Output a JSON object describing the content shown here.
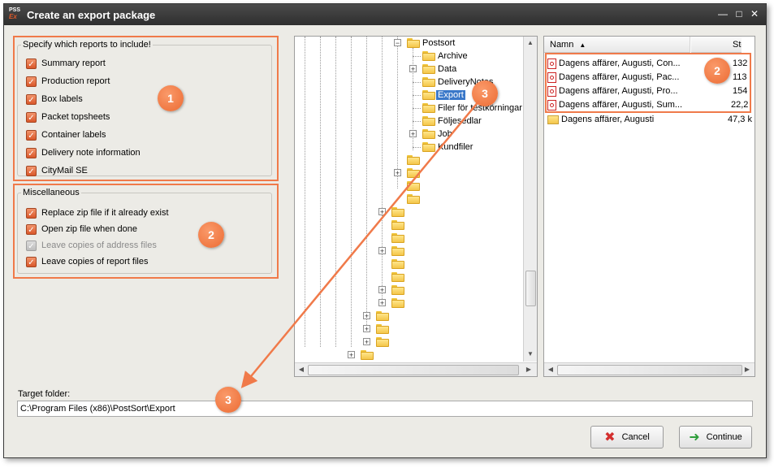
{
  "window": {
    "title": "Create an export package",
    "app_icon_text": "PSS",
    "app_icon_sub": "Ex"
  },
  "reports_group": {
    "legend": "Specify which reports to include!",
    "items": [
      {
        "label": "Summary report",
        "checked": true
      },
      {
        "label": "Production report",
        "checked": true
      },
      {
        "label": "Box labels",
        "checked": true
      },
      {
        "label": "Packet topsheets",
        "checked": true
      },
      {
        "label": "Container labels",
        "checked": true
      },
      {
        "label": "Delivery note information",
        "checked": true
      },
      {
        "label": "CityMail SE",
        "checked": true
      }
    ]
  },
  "misc_group": {
    "legend": "Miscellaneous",
    "items": [
      {
        "label": "Replace zip file if it already exist",
        "checked": true,
        "enabled": true
      },
      {
        "label": "Open zip file when done",
        "checked": true,
        "enabled": true
      },
      {
        "label": "Leave copies of address files",
        "checked": true,
        "enabled": false
      },
      {
        "label": "Leave copies of report files",
        "checked": true,
        "enabled": true
      }
    ]
  },
  "badges": {
    "b1": "1",
    "b2_left": "2",
    "b2_right": "2",
    "b3_tree": "3",
    "b3_target": "3"
  },
  "tree": {
    "root": "Postsort",
    "children": [
      "Archive",
      "Data",
      "DeliveryNotes",
      "Export",
      "Filer för testkörningar",
      "Följesedlar",
      "Job",
      "Kundfiler"
    ],
    "selected": "Export"
  },
  "file_list": {
    "columns": {
      "name": "Namn",
      "size": "Storle"
    },
    "rows": [
      {
        "name": "Dagens affärer, Augusti, Con...",
        "size": "132",
        "type": "pdf"
      },
      {
        "name": "Dagens affärer, Augusti, Pac...",
        "size": "113",
        "type": "pdf"
      },
      {
        "name": "Dagens affärer, Augusti, Pro...",
        "size": "154",
        "type": "pdf"
      },
      {
        "name": "Dagens affärer, Augusti, Sum...",
        "size": "22,2",
        "type": "pdf"
      },
      {
        "name": "Dagens affärer, Augusti",
        "size": "47,3 k",
        "type": "zip"
      }
    ]
  },
  "target": {
    "label": "Target folder:",
    "value": "C:\\Program Files (x86)\\PostSort\\Export"
  },
  "buttons": {
    "cancel": "Cancel",
    "continue": "Continue"
  },
  "colors": {
    "accent": "#f07a4a",
    "selection": "#3a78c9"
  }
}
